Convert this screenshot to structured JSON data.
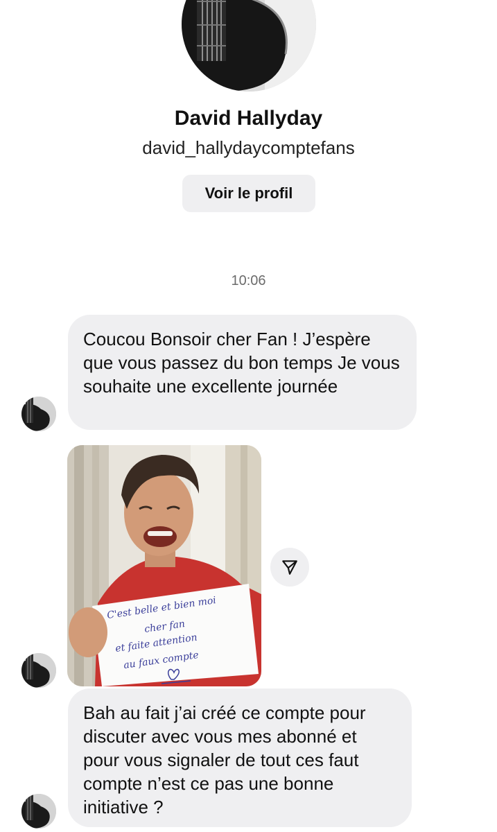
{
  "header": {
    "display_name": "David Hallyday",
    "username": "david_hallydaycomptefans",
    "view_profile_label": "Voir le profil"
  },
  "conversation": {
    "timestamp": "10:06",
    "messages": [
      {
        "type": "text",
        "text": "Coucou Bonsoir cher  Fan ! J’espère que vous passez du bon temps Je vous souhaite une excellente journée"
      },
      {
        "type": "image",
        "note_lines": [
          "C'est belle et bien moi",
          "cher fan",
          "et faite attention",
          "au faux compte"
        ]
      },
      {
        "type": "text",
        "text": "Bah au fait j’ai créé ce compte pour discuter avec vous mes abonné et pour vous signaler de tout ces faut compte n’est ce pas une bonne initiative ?"
      }
    ]
  },
  "icons": {
    "share": "send-icon",
    "profile_picture": "guitar-photo",
    "heart": "heart-icon"
  },
  "colors": {
    "bubble_bg": "#efeff1",
    "timestamp": "#6b6b6b",
    "note_ink": "#3b3f9a"
  }
}
